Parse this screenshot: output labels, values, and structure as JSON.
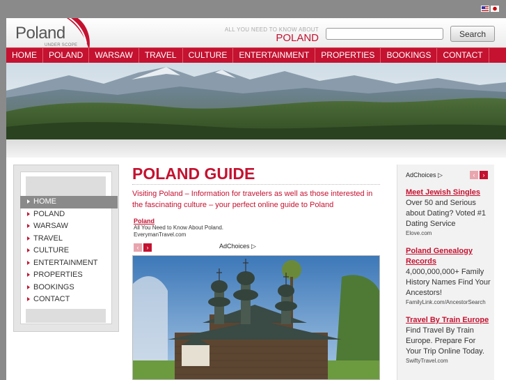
{
  "brand": {
    "logo_text": "Poland",
    "logo_sub": "UNDER SCOPE",
    "tagline_top": "ALL YOU NEED TO KNOW ABOUT",
    "tagline_main": "POLAND"
  },
  "search": {
    "placeholder": "",
    "button_label": "Search"
  },
  "nav": {
    "items": [
      "HOME",
      "POLAND",
      "WARSAW",
      "TRAVEL",
      "CULTURE",
      "ENTERTAINMENT",
      "PROPERTIES",
      "BOOKINGS",
      "CONTACT"
    ]
  },
  "sidebar": {
    "active": "HOME",
    "items": [
      "HOME",
      "POLAND",
      "WARSAW",
      "TRAVEL",
      "CULTURE",
      "ENTERTAINMENT",
      "PROPERTIES",
      "BOOKINGS",
      "CONTACT"
    ]
  },
  "main": {
    "title": "POLAND GUIDE",
    "intro": "Visiting Poland – Information for travelers as well as those interested in the fascinating culture – your perfect online guide to Poland",
    "ad": {
      "title": "Poland",
      "desc": "All You Need to Know About Poland.",
      "url": "EverymanTravel.com",
      "adchoices": "AdChoices"
    }
  },
  "right_ads": {
    "adchoices": "AdChoices",
    "items": [
      {
        "title": "Meet Jewish Singles",
        "desc": "Over 50 and Serious about Dating? Voted #1 Dating Service",
        "url": "Elove.com"
      },
      {
        "title": "Poland Genealogy Records",
        "desc": "4,000,000,000+ Family History Names Find Your Ancestors!",
        "url": "FamilyLink.com/AncestorSearch"
      },
      {
        "title": "Travel By Train Europe",
        "desc": "Find Travel By Train Europe. Prepare For Your Trip Online Today.",
        "url": "SwiftyTravel.com"
      }
    ]
  },
  "colors": {
    "accent": "#c41230",
    "frame": "#8a8a8a"
  }
}
